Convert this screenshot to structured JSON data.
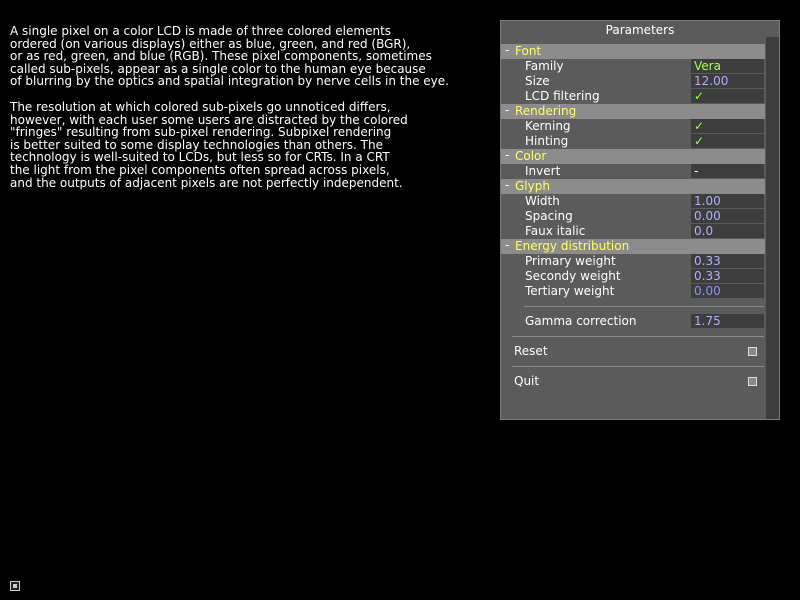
{
  "text": {
    "lines": [
      "A single pixel on a color LCD is made of three colored elements",
      "ordered (on various displays) either as blue, green, and red (BGR),",
      "or as red, green, and blue (RGB). These pixel components, sometimes",
      "called sub-pixels, appear as a single color to the human eye because",
      "of blurring by the optics and spatial integration by nerve cells in the eye.",
      "",
      "The resolution at which colored sub-pixels go unnoticed differs,",
      "however, with each user some users are distracted by the colored",
      "\"fringes\" resulting from sub-pixel rendering. Subpixel rendering",
      "is better suited to some display technologies than others. The",
      "technology is well-suited to LCDs, but less so for CRTs. In a CRT",
      "the light from the pixel components often spread across pixels,",
      "and the outputs of adjacent pixels are not perfectly independent."
    ]
  },
  "panel": {
    "title": "Parameters",
    "toggle_glyph": "-",
    "check_glyph": "✓",
    "font": {
      "label": "Font",
      "family_label": "Family",
      "family_value": "Vera",
      "size_label": "Size",
      "size_value": "12.00",
      "lcd_label": "LCD filtering"
    },
    "rendering": {
      "label": "Rendering",
      "kerning_label": "Kerning",
      "hinting_label": "Hinting"
    },
    "color": {
      "label": "Color",
      "invert_label": "Invert",
      "invert_value": "-"
    },
    "glyph": {
      "label": "Glyph",
      "width_label": "Width",
      "width_value": "1.00",
      "spacing_label": "Spacing",
      "spacing_value": "0.00",
      "faux_label": "Faux italic",
      "faux_value": "0.0"
    },
    "energy": {
      "label": "Energy distribution",
      "primary_label": "Primary weight",
      "primary_value": "0.33",
      "secondy_label": "Secondy weight",
      "secondy_value": "0.33",
      "tertiary_label": "Tertiary weight",
      "tertiary_value": "0.00"
    },
    "gamma": {
      "label": "Gamma correction",
      "value": "1.75"
    },
    "reset_label": "Reset",
    "quit_label": "Quit"
  },
  "colors": {
    "section_label": "#ffff66",
    "check": "#9bff4a",
    "value_green": "#a5ff5a",
    "value_dim": "#b0b0ff"
  }
}
